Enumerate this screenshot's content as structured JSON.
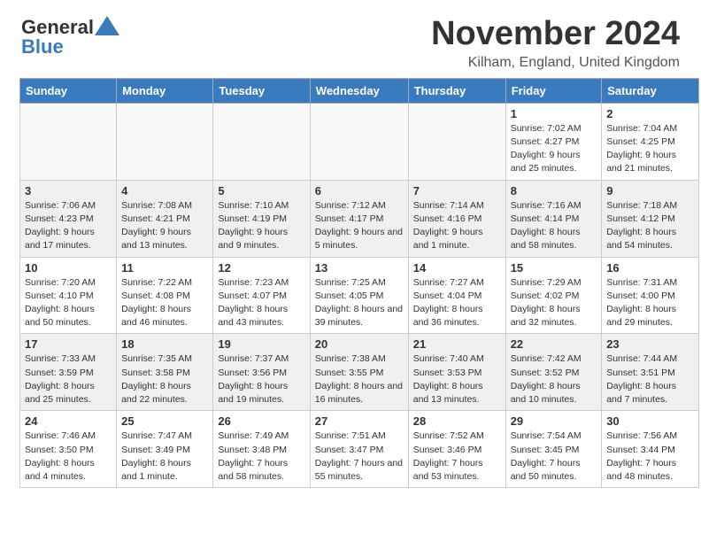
{
  "logo": {
    "general": "General",
    "blue": "Blue"
  },
  "title": "November 2024",
  "location": "Kilham, England, United Kingdom",
  "headers": [
    "Sunday",
    "Monday",
    "Tuesday",
    "Wednesday",
    "Thursday",
    "Friday",
    "Saturday"
  ],
  "weeks": [
    [
      {
        "num": "",
        "info": ""
      },
      {
        "num": "",
        "info": ""
      },
      {
        "num": "",
        "info": ""
      },
      {
        "num": "",
        "info": ""
      },
      {
        "num": "",
        "info": ""
      },
      {
        "num": "1",
        "info": "Sunrise: 7:02 AM\nSunset: 4:27 PM\nDaylight: 9 hours and 25 minutes."
      },
      {
        "num": "2",
        "info": "Sunrise: 7:04 AM\nSunset: 4:25 PM\nDaylight: 9 hours and 21 minutes."
      }
    ],
    [
      {
        "num": "3",
        "info": "Sunrise: 7:06 AM\nSunset: 4:23 PM\nDaylight: 9 hours and 17 minutes."
      },
      {
        "num": "4",
        "info": "Sunrise: 7:08 AM\nSunset: 4:21 PM\nDaylight: 9 hours and 13 minutes."
      },
      {
        "num": "5",
        "info": "Sunrise: 7:10 AM\nSunset: 4:19 PM\nDaylight: 9 hours and 9 minutes."
      },
      {
        "num": "6",
        "info": "Sunrise: 7:12 AM\nSunset: 4:17 PM\nDaylight: 9 hours and 5 minutes."
      },
      {
        "num": "7",
        "info": "Sunrise: 7:14 AM\nSunset: 4:16 PM\nDaylight: 9 hours and 1 minute."
      },
      {
        "num": "8",
        "info": "Sunrise: 7:16 AM\nSunset: 4:14 PM\nDaylight: 8 hours and 58 minutes."
      },
      {
        "num": "9",
        "info": "Sunrise: 7:18 AM\nSunset: 4:12 PM\nDaylight: 8 hours and 54 minutes."
      }
    ],
    [
      {
        "num": "10",
        "info": "Sunrise: 7:20 AM\nSunset: 4:10 PM\nDaylight: 8 hours and 50 minutes."
      },
      {
        "num": "11",
        "info": "Sunrise: 7:22 AM\nSunset: 4:08 PM\nDaylight: 8 hours and 46 minutes."
      },
      {
        "num": "12",
        "info": "Sunrise: 7:23 AM\nSunset: 4:07 PM\nDaylight: 8 hours and 43 minutes."
      },
      {
        "num": "13",
        "info": "Sunrise: 7:25 AM\nSunset: 4:05 PM\nDaylight: 8 hours and 39 minutes."
      },
      {
        "num": "14",
        "info": "Sunrise: 7:27 AM\nSunset: 4:04 PM\nDaylight: 8 hours and 36 minutes."
      },
      {
        "num": "15",
        "info": "Sunrise: 7:29 AM\nSunset: 4:02 PM\nDaylight: 8 hours and 32 minutes."
      },
      {
        "num": "16",
        "info": "Sunrise: 7:31 AM\nSunset: 4:00 PM\nDaylight: 8 hours and 29 minutes."
      }
    ],
    [
      {
        "num": "17",
        "info": "Sunrise: 7:33 AM\nSunset: 3:59 PM\nDaylight: 8 hours and 25 minutes."
      },
      {
        "num": "18",
        "info": "Sunrise: 7:35 AM\nSunset: 3:58 PM\nDaylight: 8 hours and 22 minutes."
      },
      {
        "num": "19",
        "info": "Sunrise: 7:37 AM\nSunset: 3:56 PM\nDaylight: 8 hours and 19 minutes."
      },
      {
        "num": "20",
        "info": "Sunrise: 7:38 AM\nSunset: 3:55 PM\nDaylight: 8 hours and 16 minutes."
      },
      {
        "num": "21",
        "info": "Sunrise: 7:40 AM\nSunset: 3:53 PM\nDaylight: 8 hours and 13 minutes."
      },
      {
        "num": "22",
        "info": "Sunrise: 7:42 AM\nSunset: 3:52 PM\nDaylight: 8 hours and 10 minutes."
      },
      {
        "num": "23",
        "info": "Sunrise: 7:44 AM\nSunset: 3:51 PM\nDaylight: 8 hours and 7 minutes."
      }
    ],
    [
      {
        "num": "24",
        "info": "Sunrise: 7:46 AM\nSunset: 3:50 PM\nDaylight: 8 hours and 4 minutes."
      },
      {
        "num": "25",
        "info": "Sunrise: 7:47 AM\nSunset: 3:49 PM\nDaylight: 8 hours and 1 minute."
      },
      {
        "num": "26",
        "info": "Sunrise: 7:49 AM\nSunset: 3:48 PM\nDaylight: 7 hours and 58 minutes."
      },
      {
        "num": "27",
        "info": "Sunrise: 7:51 AM\nSunset: 3:47 PM\nDaylight: 7 hours and 55 minutes."
      },
      {
        "num": "28",
        "info": "Sunrise: 7:52 AM\nSunset: 3:46 PM\nDaylight: 7 hours and 53 minutes."
      },
      {
        "num": "29",
        "info": "Sunrise: 7:54 AM\nSunset: 3:45 PM\nDaylight: 7 hours and 50 minutes."
      },
      {
        "num": "30",
        "info": "Sunrise: 7:56 AM\nSunset: 3:44 PM\nDaylight: 7 hours and 48 minutes."
      }
    ]
  ]
}
